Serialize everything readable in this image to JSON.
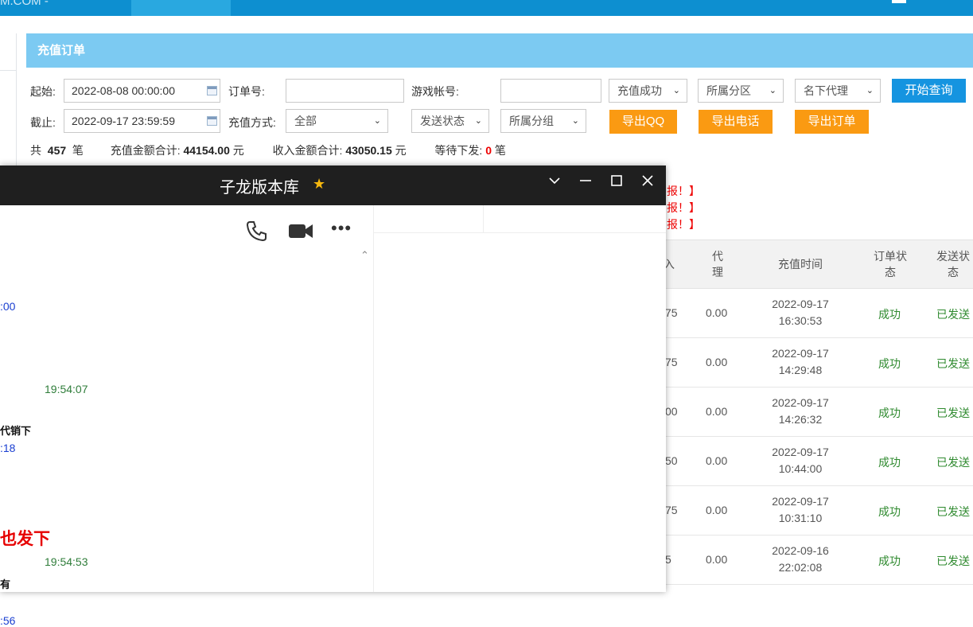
{
  "header": {
    "brand": "M.COM -"
  },
  "panel": {
    "title": "充值订单"
  },
  "filters": {
    "start_label": "起始:",
    "start_value": "2022-08-08 00:00:00",
    "end_label": "截止:",
    "end_value": "2022-09-17 23:59:59",
    "order_no_label": "订单号:",
    "order_no_value": "",
    "game_account_label": "游戏帐号:",
    "game_account_value": "",
    "pay_method_label": "充值方式:",
    "pay_method_value": "全部",
    "recharge_status": "充值成功",
    "region": "所属分区",
    "agent": "名下代理",
    "send_status": "发送状态",
    "group": "所属分组"
  },
  "buttons": {
    "search": "开始查询",
    "export_qq": "导出QQ",
    "export_phone": "导出电话",
    "export_orders": "导出订单"
  },
  "summary": {
    "total_prefix": "共",
    "total_count": "457",
    "total_unit": "笔",
    "recharge_label": "充值金额合计:",
    "recharge_amount": "44154.00",
    "income_label": "收入金额合计:",
    "income_amount": "43050.15",
    "currency": "元",
    "pending_label": "等待下发:",
    "pending_count": "0",
    "pending_unit": "笔"
  },
  "notices": [
    "报！】",
    "报！】",
    "报！】"
  ],
  "table": {
    "headers": {
      "income_partial": "入",
      "agent": "代理",
      "time": "充值时间",
      "order_status": "订单状态",
      "send_status": "发送状态"
    },
    "rows": [
      {
        "income": "75",
        "agent": "0.00",
        "date": "2022-09-17",
        "time": "16:30:53",
        "status": "成功",
        "send": "已发送"
      },
      {
        "income": "75",
        "agent": "0.00",
        "date": "2022-09-17",
        "time": "14:29:48",
        "status": "成功",
        "send": "已发送"
      },
      {
        "income": "00",
        "agent": "0.00",
        "date": "2022-09-17",
        "time": "14:26:32",
        "status": "成功",
        "send": "已发送"
      },
      {
        "income": "50",
        "agent": "0.00",
        "date": "2022-09-17",
        "time": "10:44:00",
        "status": "成功",
        "send": "已发送"
      },
      {
        "income": "75",
        "agent": "0.00",
        "date": "2022-09-17",
        "time": "10:31:10",
        "status": "成功",
        "send": "已发送"
      },
      {
        "income": "5",
        "agent": "0.00",
        "date": "2022-09-16",
        "time": "22:02:08",
        "status": "成功",
        "send": "已发送"
      }
    ]
  },
  "chat": {
    "title": "子龙版本库",
    "messages": [
      {
        "text": ":00"
      },
      {
        "text": "19:54:07"
      },
      {
        "text": "代销下"
      },
      {
        "text": ":18"
      },
      {
        "text": "也发下"
      },
      {
        "text": "19:54:53"
      },
      {
        "text": "有"
      },
      {
        "text": ":56"
      }
    ]
  },
  "colors": {
    "header_blue": "#0d8fd0",
    "panel_head": "#7ccaf2",
    "btn_blue": "#1594e0",
    "btn_orange": "#fa9a12",
    "success_green": "#2f8a2f"
  }
}
